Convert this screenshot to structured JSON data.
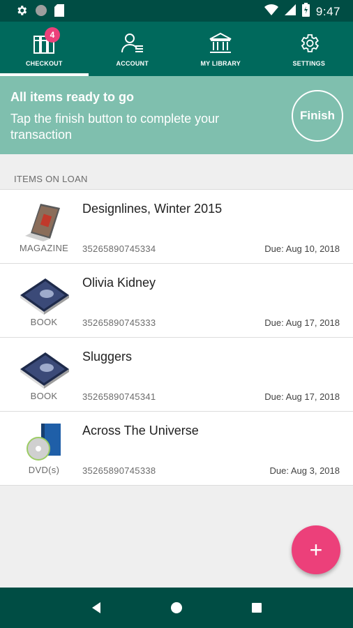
{
  "status_bar": {
    "time": "9:47",
    "left_icons": [
      "gear-icon",
      "circle-icon",
      "sim-card-icon"
    ],
    "right_icons": [
      "wifi-icon",
      "signal-icon",
      "battery-charging-icon"
    ]
  },
  "tabs": [
    {
      "label": "CHECKOUT",
      "icon": "books-icon",
      "active": true,
      "badge": "4"
    },
    {
      "label": "ACCOUNT",
      "icon": "account-icon",
      "active": false
    },
    {
      "label": "MY LIBRARY",
      "icon": "library-building-icon",
      "active": false
    },
    {
      "label": "SETTINGS",
      "icon": "gear-icon",
      "active": false
    }
  ],
  "banner": {
    "title": "All items ready to go",
    "text": "Tap the finish button to complete your transaction",
    "finish_label": "Finish"
  },
  "section": {
    "title": "ITEMS ON LOAN"
  },
  "items": [
    {
      "type": "MAGAZINE",
      "title": "Designlines, Winter 2015",
      "barcode": "35265890745334",
      "due": "Due: Aug 10, 2018",
      "icon": "magazine-icon"
    },
    {
      "type": "BOOK",
      "title": "Olivia Kidney",
      "barcode": "35265890745333",
      "due": "Due: Aug 17, 2018",
      "icon": "book-icon"
    },
    {
      "type": "BOOK",
      "title": "Sluggers",
      "barcode": "35265890745341",
      "due": "Due: Aug 17, 2018",
      "icon": "book-icon"
    },
    {
      "type": "DVD(s)",
      "title": "Across The Universe",
      "barcode": "35265890745338",
      "due": "Due: Aug 3, 2018",
      "icon": "dvd-icon"
    }
  ],
  "fab": {
    "label": "+",
    "icon": "add-icon"
  },
  "nav": {
    "buttons": [
      "back-icon",
      "home-icon",
      "recents-icon"
    ]
  },
  "colors": {
    "primary_dark": "#004d44",
    "primary": "#00695c",
    "banner": "#7fbfae",
    "accent": "#ec407a"
  }
}
